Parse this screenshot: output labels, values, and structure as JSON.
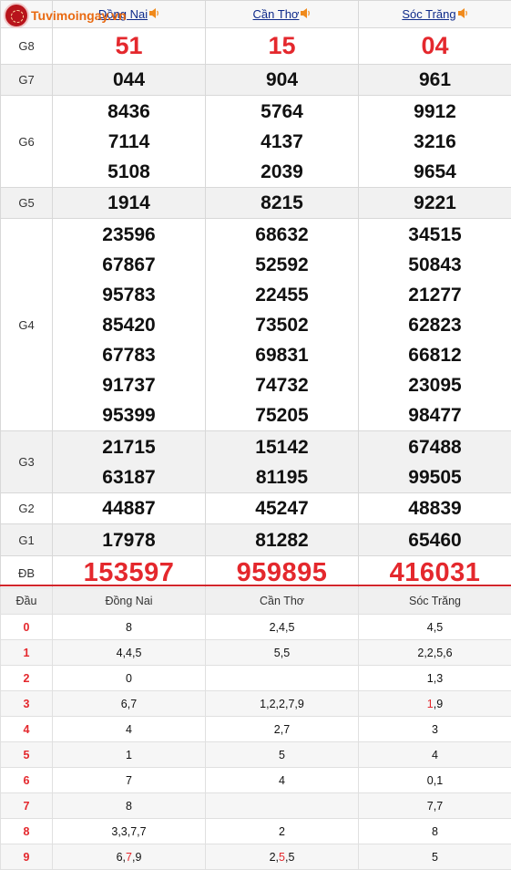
{
  "logo": {
    "text": "Tuvimoingay.vn"
  },
  "header": {
    "provinces": [
      "Đồng Nai",
      "Cần Thơ",
      "Sóc Trăng"
    ]
  },
  "prizes": {
    "g8": {
      "label": "G8",
      "values": [
        "51",
        "15",
        "04"
      ]
    },
    "g7": {
      "label": "G7",
      "values": [
        "044",
        "904",
        "961"
      ]
    },
    "g6": {
      "label": "G6",
      "values": [
        [
          "8436",
          "7114",
          "5108"
        ],
        [
          "5764",
          "4137",
          "2039"
        ],
        [
          "9912",
          "3216",
          "9654"
        ]
      ]
    },
    "g5": {
      "label": "G5",
      "values": [
        "1914",
        "8215",
        "9221"
      ]
    },
    "g4": {
      "label": "G4",
      "values": [
        [
          "23596",
          "67867",
          "95783",
          "85420",
          "67783",
          "91737",
          "95399"
        ],
        [
          "68632",
          "52592",
          "22455",
          "73502",
          "69831",
          "74732",
          "75205"
        ],
        [
          "34515",
          "50843",
          "21277",
          "62823",
          "66812",
          "23095",
          "98477"
        ]
      ]
    },
    "g3": {
      "label": "G3",
      "values": [
        [
          "21715",
          "63187"
        ],
        [
          "15142",
          "81195"
        ],
        [
          "67488",
          "99505"
        ]
      ]
    },
    "g2": {
      "label": "G2",
      "values": [
        "44887",
        "45247",
        "48839"
      ]
    },
    "g1": {
      "label": "G1",
      "values": [
        "17978",
        "81282",
        "65460"
      ]
    },
    "db": {
      "label": "ĐB",
      "values": [
        "153597",
        "959895",
        "416031"
      ]
    }
  },
  "loto": {
    "headers": [
      "Đầu",
      "Đồng Nai",
      "Cần Thơ",
      "Sóc Trăng"
    ],
    "rows": [
      {
        "dau": "0",
        "cells": [
          [
            "8"
          ],
          [
            "2,4,5"
          ],
          [
            "4,5"
          ]
        ]
      },
      {
        "dau": "1",
        "cells": [
          [
            "4,4,5"
          ],
          [
            "5,5"
          ],
          [
            "2,2,5,6"
          ]
        ]
      },
      {
        "dau": "2",
        "cells": [
          [
            "0"
          ],
          [
            ""
          ],
          [
            "1,3"
          ]
        ]
      },
      {
        "dau": "3",
        "cells": [
          [
            "6,7"
          ],
          [
            "1,2,2,7,9"
          ],
          [
            "",
            "1",
            ",9"
          ]
        ]
      },
      {
        "dau": "4",
        "cells": [
          [
            "4"
          ],
          [
            "2,7"
          ],
          [
            "3"
          ]
        ]
      },
      {
        "dau": "5",
        "cells": [
          [
            "1"
          ],
          [
            "5"
          ],
          [
            "4"
          ]
        ]
      },
      {
        "dau": "6",
        "cells": [
          [
            "7"
          ],
          [
            "4"
          ],
          [
            "0,1"
          ]
        ]
      },
      {
        "dau": "7",
        "cells": [
          [
            "8"
          ],
          [
            ""
          ],
          [
            "7,7"
          ]
        ]
      },
      {
        "dau": "8",
        "cells": [
          [
            "3,3,7,7"
          ],
          [
            "2"
          ],
          [
            "8"
          ]
        ]
      },
      {
        "dau": "9",
        "cells": [
          [
            "6,",
            "7",
            ",9"
          ],
          [
            "2,",
            "5",
            ",5"
          ],
          [
            "5"
          ]
        ]
      }
    ]
  },
  "colors": {
    "accent_red": "#e4282d",
    "link_blue": "#0e2a8a",
    "logo_orange": "#e96a12"
  },
  "icons": [
    "logo-badge-icon",
    "speaker-icon"
  ]
}
